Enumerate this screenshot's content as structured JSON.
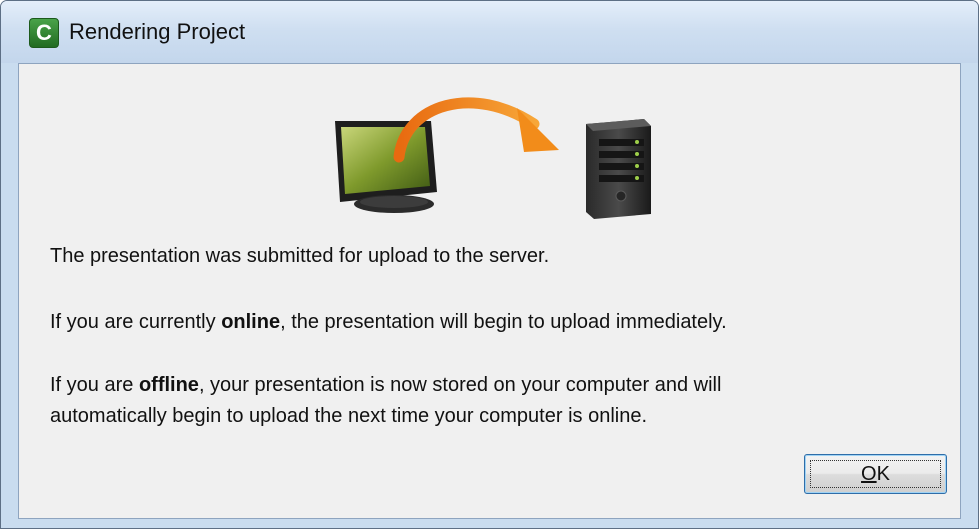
{
  "window": {
    "title": "Rendering Project",
    "app_icon_letter": "C"
  },
  "illustration": {
    "source_icon": "monitor-icon",
    "arrow_icon": "curved-arrow-icon",
    "target_icon": "server-icon",
    "arrow_color": "#f28c1a"
  },
  "message": {
    "line1": "The presentation was submitted for upload to the server.",
    "online_pre": "If you are currently ",
    "online_bold": "online",
    "online_post": ", the presentation will begin to upload immediately.",
    "offline_pre": "If you are ",
    "offline_bold": "offline",
    "offline_post": ", your presentation is now stored on your computer and will",
    "offline_line2": "automatically begin to upload the next time your computer is online."
  },
  "buttons": {
    "ok_mnemonic": "O",
    "ok_rest": "K"
  }
}
